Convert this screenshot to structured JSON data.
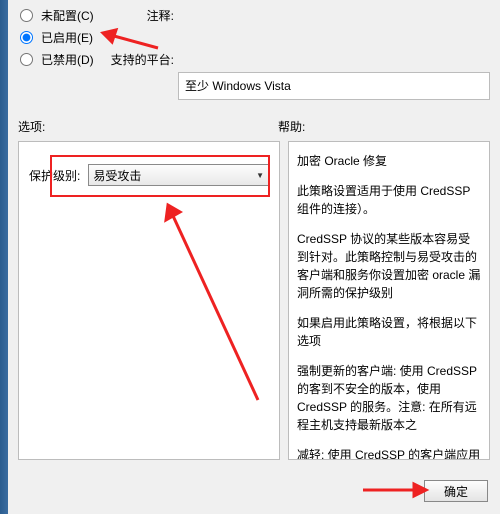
{
  "radios": {
    "not_configured": {
      "label": "未配置(C)"
    },
    "enabled": {
      "label": "已启用(E)"
    },
    "disabled": {
      "label": "已禁用(D)"
    }
  },
  "top": {
    "comment_label": "注释:",
    "platform_label": "支持的平台:",
    "platform_value": "至少 Windows Vista"
  },
  "section": {
    "options": "选项:",
    "help": "帮助:"
  },
  "protect": {
    "label": "保护级别:",
    "selected": "易受攻击"
  },
  "help": {
    "p1": "加密 Oracle 修复",
    "p2": "此策略设置适用于使用 CredSSP 组件的连接）。",
    "p3": "CredSSP 协议的某些版本容易受到针对。此策略控制与易受攻击的客户端和服务你设置加密 oracle 漏洞所需的保护级别",
    "p4": "如果启用此策略设置，将根据以下选项",
    "p5": "强制更新的客户端: 使用 CredSSP 的客到不安全的版本，使用 CredSSP 的服务。注意: 在所有远程主机支持最新版本之",
    "p6": "减轻: 使用 CredSSP 的客户端应用程序本，但使用 CredSSP 的服务将接受未将修补客户端所造成的风险的重要信息，诸"
  },
  "buttons": {
    "ok": "确定"
  }
}
